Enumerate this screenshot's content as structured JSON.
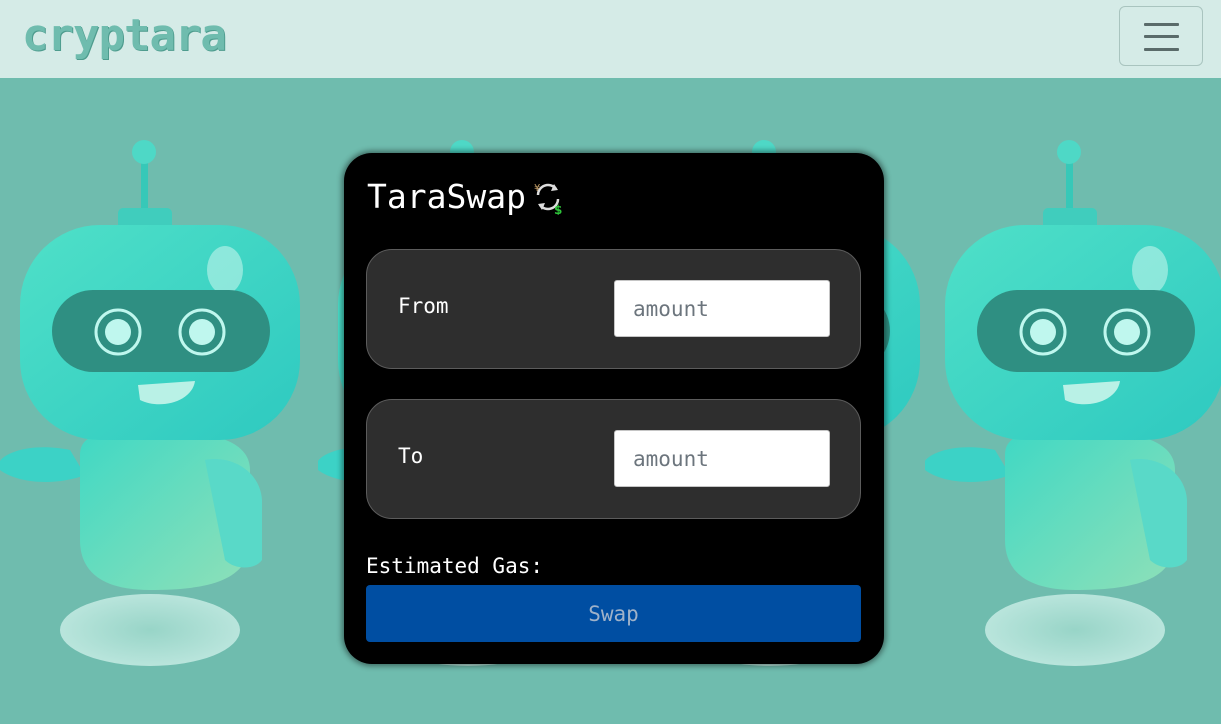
{
  "navbar": {
    "brand": "cryptara",
    "toggle_icon": "hamburger-menu-icon"
  },
  "background": {
    "illustration": "robot-mascot-illustration"
  },
  "card": {
    "title": "TaraSwap",
    "title_icon": "currency-swap-icon",
    "from": {
      "label": "From",
      "placeholder": "amount",
      "value": ""
    },
    "to": {
      "label": "To",
      "placeholder": "amount",
      "value": ""
    },
    "gas_label": "Estimated Gas:",
    "swap_button": "Swap"
  },
  "colors": {
    "navbar_bg": "#d5ebe7",
    "page_bg": "#6fbcae",
    "card_bg": "#000000",
    "panel_bg": "#2e2e2e",
    "button_bg": "#004ea2"
  }
}
